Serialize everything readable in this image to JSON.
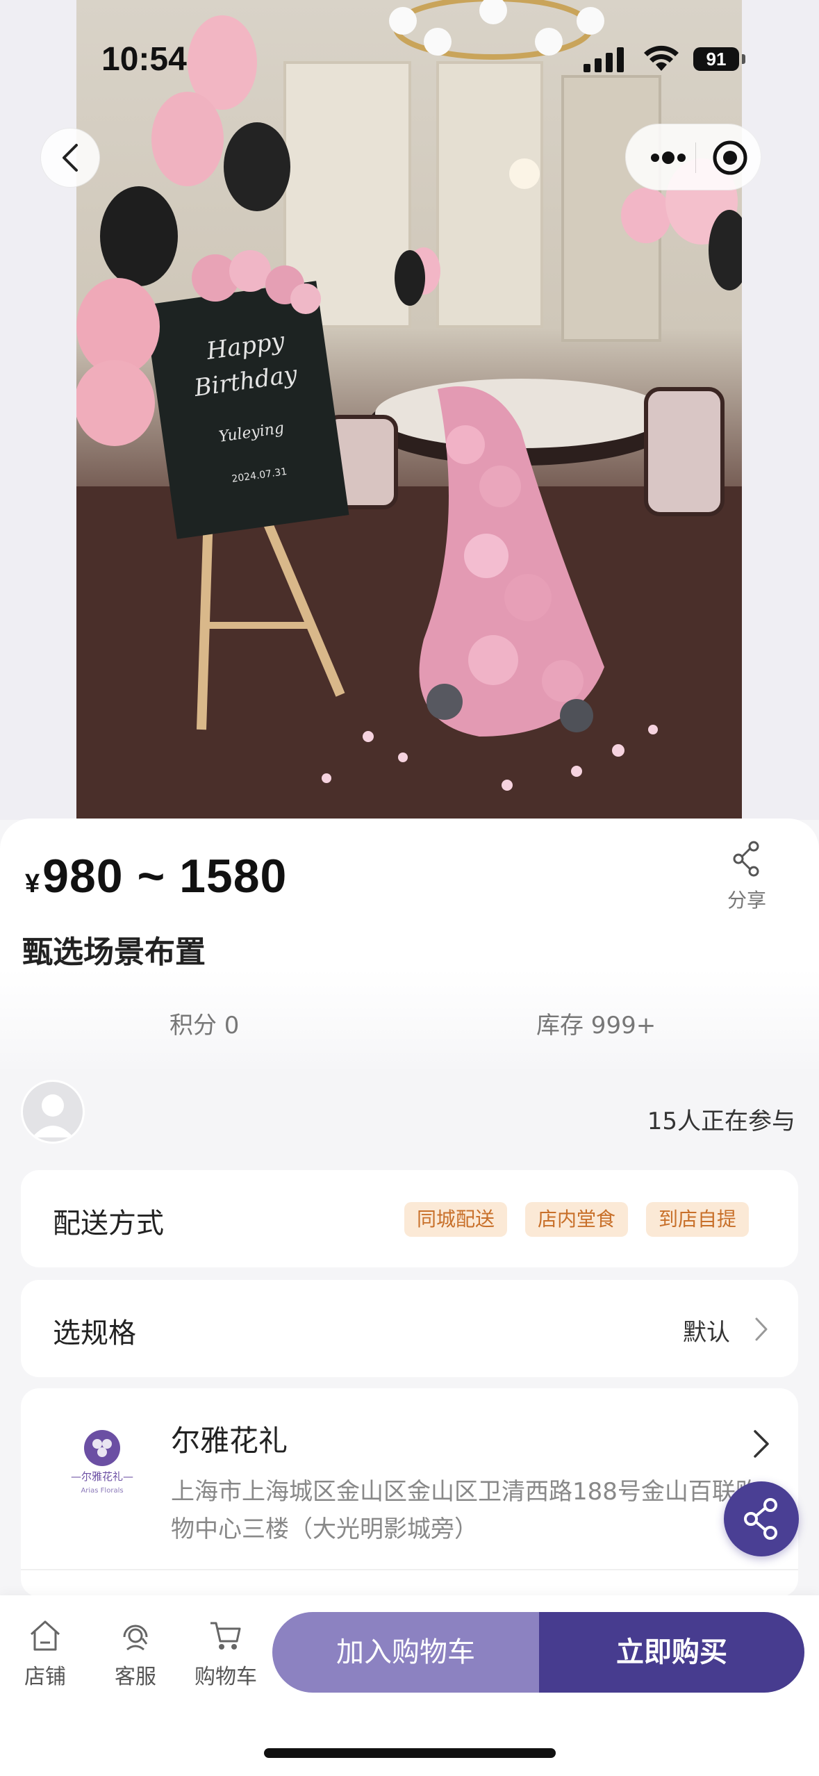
{
  "status_bar": {
    "time": "10:54",
    "battery": "91",
    "icons": [
      "signal-icon",
      "wifi-icon",
      "battery-icon"
    ]
  },
  "photo": {
    "sign_text": [
      "Happy",
      "Birthday",
      "Yuleying",
      "2024.07.31"
    ],
    "description_icon": "product-photo"
  },
  "nav": {
    "back_icon": "chevron-left-icon",
    "more_icon": "more-dots-icon",
    "target_icon": "target-icon"
  },
  "product": {
    "currency": "¥",
    "price_range": "980 ~ 1580",
    "title": "甄选场景布置",
    "share_label": "分享",
    "points": "积分 0",
    "stock": "库存 999+"
  },
  "participants": {
    "text": "15人正在参与"
  },
  "delivery": {
    "label": "配送方式",
    "tags": [
      "同城配送",
      "店内堂食",
      "到店自提"
    ]
  },
  "spec": {
    "label": "选规格",
    "value": "默认"
  },
  "store": {
    "name": "尔雅花礼",
    "address": "上海市上海城区金山区金山区卫清西路188号金山百联购物中心三楼（大光明影城旁）",
    "logo_text": "—尔雅花礼—",
    "logo_subtext": "Arias Florals"
  },
  "bottom_bar": {
    "tabs": [
      {
        "label": "店铺",
        "icon": "home-icon"
      },
      {
        "label": "客服",
        "icon": "customer-service-icon"
      },
      {
        "label": "购物车",
        "icon": "cart-icon"
      }
    ],
    "add_to_cart": "加入购物车",
    "buy_now": "立即购买"
  },
  "colors": {
    "accent": "#473c8f",
    "accent_light": "#8c82c1",
    "tag_bg": "#fbe9d6",
    "tag_text": "#c8702a"
  }
}
